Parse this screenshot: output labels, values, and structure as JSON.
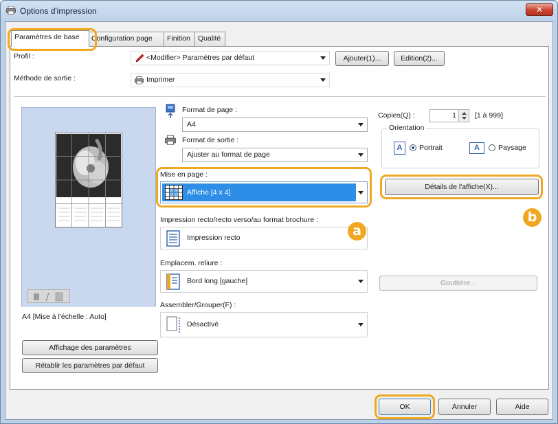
{
  "window": {
    "title": "Options d'impression",
    "close_glyph": "✕"
  },
  "tabs": [
    {
      "label": "Paramètres de base",
      "active": true
    },
    {
      "label": "Configuration page",
      "active": false
    },
    {
      "label": "Finition",
      "active": false
    },
    {
      "label": "Qualité",
      "active": false
    }
  ],
  "profile": {
    "label": "Profil :",
    "value": "<Modifier> Paramètres par défaut",
    "add_button": "Ajouter(1)...",
    "edit_button": "Edition(2)..."
  },
  "output_method": {
    "label": "Méthode de sortie :",
    "value": "Imprimer"
  },
  "preview": {
    "caption": "A4 [Mise à l'échelle : Auto]",
    "show_settings_button": "Affichage des paramètres",
    "restore_defaults_button": "Rétablir les paramètres par défaut"
  },
  "page_size": {
    "label": "Format de page :",
    "value": "A4"
  },
  "output_size": {
    "label": "Format de sortie :",
    "value": "Ajuster au format de page"
  },
  "page_layout": {
    "label": "Mise en page :",
    "value": "Affiche [4 x 4]"
  },
  "duplex": {
    "label": "Impression recto/recto verso/au format brochure :",
    "value": "Impression recto"
  },
  "binding": {
    "label": "Emplacem. reliure :",
    "value": "Bord long [gauche]",
    "gutter_button": "Gouttière..."
  },
  "collate": {
    "label": "Assembler/Grouper(F) :",
    "value": "Désactivé"
  },
  "copies": {
    "label": "Copies(Q) :",
    "value": "1",
    "range": "[1 à 999]"
  },
  "orientation": {
    "label": "Orientation",
    "portrait": "Portrait",
    "landscape": "Paysage",
    "selected": "Portrait"
  },
  "poster_details_button": "Détails de l'affiche(X)...",
  "footer": {
    "ok": "OK",
    "cancel": "Annuler",
    "help": "Aide"
  },
  "callouts": {
    "a": "a",
    "b": "b"
  },
  "colors": {
    "highlight": "#f0a820",
    "selection": "#2e8de6",
    "titlebar": "#bdd1e8",
    "close_red": "#c9442f"
  }
}
